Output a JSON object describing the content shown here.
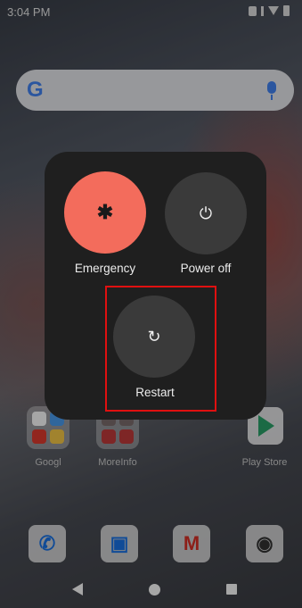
{
  "status_bar": {
    "time": "3:04 PM"
  },
  "home": {
    "folders": [
      {
        "label": "Googl",
        "tile_colors": [
          "#ffffff",
          "#4a9df0",
          "#e03b2e",
          "#f7c948"
        ]
      },
      {
        "label": "MoreInfo",
        "tile_colors": [
          "#7d6e6e",
          "#7d6e6e",
          "#c23b3b",
          "#c23b3b"
        ]
      }
    ],
    "apps": [
      {
        "label": "Play Store",
        "icon": "play-store-icon"
      }
    ],
    "dock": [
      {
        "name": "phone",
        "icon": "phone-icon",
        "glyph": "✆"
      },
      {
        "name": "contacts",
        "icon": "contacts-icon",
        "glyph": "▣"
      },
      {
        "name": "gmail",
        "icon": "gmail-icon",
        "glyph": "M"
      },
      {
        "name": "camera",
        "icon": "camera-icon",
        "glyph": "◉"
      }
    ]
  },
  "power_menu": {
    "emergency_label": "Emergency",
    "power_off_label": "Power off",
    "restart_label": "Restart",
    "emergency_glyph": "✱",
    "power_glyph": "⏻",
    "restart_glyph": "↻"
  },
  "colors": {
    "emergency": "#f36c5c",
    "button_dark": "#3a3a3a",
    "panel": "#1f1f1f",
    "highlight": "#e01010"
  }
}
